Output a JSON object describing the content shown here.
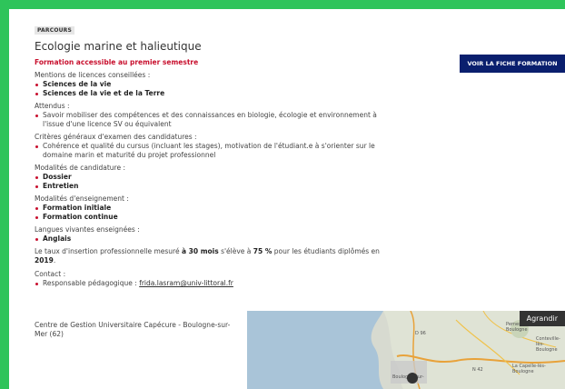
{
  "tag": "PARCOURS",
  "title": "Ecologie marine et halieutique",
  "alert": "Formation accessible au premier semestre",
  "button_label": "VOIR LA FICHE FORMATION",
  "sections": {
    "mentions": {
      "title": "Mentions de licences conseillées :",
      "items": [
        "Sciences de la vie",
        "Sciences de la vie et de la Terre"
      ]
    },
    "attendus": {
      "title": "Attendus :",
      "items": [
        "Savoir mobiliser des compétences et des connaissances en biologie, écologie et environnement à l'issue d'une licence SV ou équivalent"
      ]
    },
    "criteres": {
      "title": "Critères généraux d'examen des candidatures :",
      "items": [
        "Cohérence et qualité du cursus (incluant les stages), motivation de l'étudiant.e à s'orienter sur le domaine marin et maturité du projet professionnel"
      ]
    },
    "modalites_cand": {
      "title": "Modalités de candidature :",
      "items": [
        "Dossier",
        "Entretien"
      ]
    },
    "modalites_ens": {
      "title": "Modalités d'enseignement :",
      "items": [
        "Formation initiale",
        "Formation continue"
      ]
    },
    "langues": {
      "title": "Langues vivantes enseignées :",
      "items": [
        "Anglais"
      ]
    }
  },
  "insertion": {
    "prefix": "Le taux d'insertion professionnelle mesuré ",
    "duration": "à 30 mois",
    "middle": " s'élève à ",
    "rate": "75 %",
    "suffix": " pour les étudiants diplômés en ",
    "year": "2019",
    "end": "."
  },
  "contact": {
    "title": "Contact :",
    "label": "Responsable pédagogique : ",
    "email": "frida.lasram@univ-littoral.fr"
  },
  "address": "Centre de Gestion Universitaire Capécure - Boulogne-sur-Mer (62)",
  "map": {
    "expand_label": "Agrandir",
    "labels": [
      "D 96",
      "Pernes-lès-Boulogne",
      "Conteville-lès-Boulogne",
      "N 42",
      "Boulogne-sur-",
      "La Capelle-lès-Boulogne"
    ]
  },
  "colors": {
    "page_bg": "#2ec45a",
    "accent_red": "#c8102e",
    "button_bg": "#0a1f6e"
  }
}
